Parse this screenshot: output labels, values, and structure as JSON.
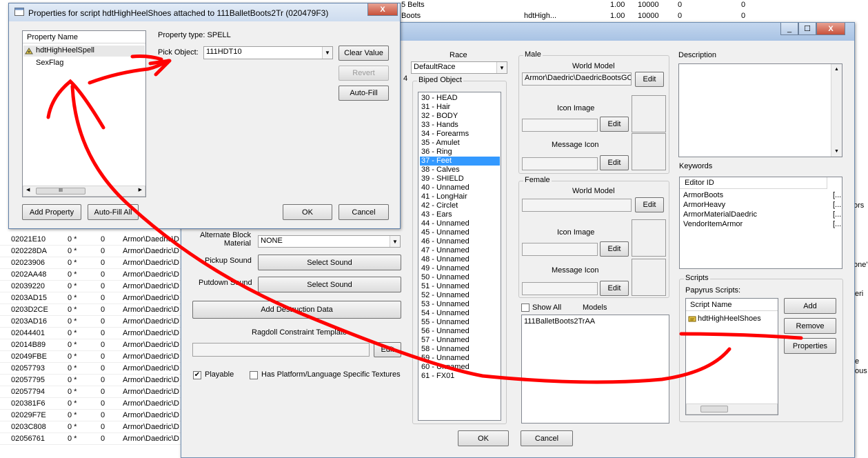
{
  "background_sheet": {
    "top_rows": [
      {
        "name": "5 Belts",
        "v1": "1.00",
        "v2": "10000",
        "v3": "0",
        "v4": "0",
        "extra": ""
      },
      {
        "name": "Boots",
        "v1": "1.00",
        "v2": "10000",
        "v3": "0",
        "v4": "0",
        "extra": "hdtHigh..."
      }
    ],
    "rows": [
      {
        "id": "02021E10",
        "n": "0 *",
        "z": "0",
        "path": "Armor\\Daedric\\D"
      },
      {
        "id": "020228DA",
        "n": "0 *",
        "z": "0",
        "path": "Armor\\Daedric\\D"
      },
      {
        "id": "02023906",
        "n": "0 *",
        "z": "0",
        "path": "Armor\\Daedric\\D"
      },
      {
        "id": "0202AA48",
        "n": "0 *",
        "z": "0",
        "path": "Armor\\Daedric\\D"
      },
      {
        "id": "02039220",
        "n": "0 *",
        "z": "0",
        "path": "Armor\\Daedric\\D"
      },
      {
        "id": "0203AD15",
        "n": "0 *",
        "z": "0",
        "path": "Armor\\Daedric\\D"
      },
      {
        "id": "0203D2CE",
        "n": "0 *",
        "z": "0",
        "path": "Armor\\Daedric\\D"
      },
      {
        "id": "0203AD16",
        "n": "0 *",
        "z": "0",
        "path": "Armor\\Daedric\\D"
      },
      {
        "id": "02044401",
        "n": "0 *",
        "z": "0",
        "path": "Armor\\Daedric\\D"
      },
      {
        "id": "02014B89",
        "n": "0 *",
        "z": "0",
        "path": "Armor\\Daedric\\D"
      },
      {
        "id": "02049FBE",
        "n": "0 *",
        "z": "0",
        "path": "Armor\\Daedric\\D"
      },
      {
        "id": "02057793",
        "n": "0 *",
        "z": "0",
        "path": "Armor\\Daedric\\D"
      },
      {
        "id": "02057795",
        "n": "0 *",
        "z": "0",
        "path": "Armor\\Daedric\\D"
      },
      {
        "id": "02057794",
        "n": "0 *",
        "z": "0",
        "path": "Armor\\Daedric\\D"
      },
      {
        "id": "020381F6",
        "n": "0 *",
        "z": "0",
        "path": "Armor\\Daedric\\D"
      },
      {
        "id": "02029F7E",
        "n": "0 *",
        "z": "0",
        "path": "Armor\\Daedric\\D"
      },
      {
        "id": "0203C808",
        "n": "0 *",
        "z": "0",
        "path": "Armor\\Daedric\\D"
      },
      {
        "id": "02056761",
        "n": "0 *",
        "z": "0",
        "path": "Armor\\Daedric\\D"
      }
    ],
    "right_edge": {
      "a": "ors",
      "b": "one'",
      "c": "eri",
      "d": "e",
      "e": "ous"
    }
  },
  "armor_window": {
    "race_label": "Race",
    "race_value": "DefaultRace",
    "biped_label": "Biped Object",
    "biped_items": [
      "30 - HEAD",
      "31 - Hair",
      "32 - BODY",
      "33 - Hands",
      "34 - Forearms",
      "35 - Amulet",
      "36 - Ring",
      "37 - Feet",
      "38 - Calves",
      "39 - SHIELD",
      "40 - Unnamed",
      "41 - LongHair",
      "42 - Circlet",
      "43 - Ears",
      "44 - Unnamed",
      "45 - Unnamed",
      "46 - Unnamed",
      "47 - Unnamed",
      "48 - Unnamed",
      "49 - Unnamed",
      "50 - Unnamed",
      "51 - Unnamed",
      "52 - Unnamed",
      "53 - Unnamed",
      "54 - Unnamed",
      "55 - Unnamed",
      "56 - Unnamed",
      "57 - Unnamed",
      "58 - Unnamed",
      "59 - Unnamed",
      "60 - Unnamed",
      "61 - FX01"
    ],
    "selected_biped": "37 - Feet",
    "male_label": "Male",
    "female_label": "Female",
    "world_model_label": "World Model",
    "male_world_model": "Armor\\Daedric\\DaedricBootsGO",
    "icon_image_label": "Icon Image",
    "message_icon_label": "Message Icon",
    "edit": "Edit",
    "show_all": "Show All",
    "models_label": "Models",
    "models_item": "111BalletBoots2TrAA",
    "description_label": "Description",
    "keywords_label": "Keywords",
    "editor_id_header": "Editor ID",
    "keywords": [
      "ArmorBoots",
      "ArmorHeavy",
      "ArmorMaterialDaedric",
      "VendorItemArmor"
    ],
    "keyword_suffix": "[...",
    "scripts_label": "Scripts",
    "papyrus_label": "Papyrus Scripts:",
    "script_name_header": "Script Name",
    "scripts": [
      "hdtHighHeelShoes"
    ],
    "add": "Add",
    "remove": "Remove",
    "properties": "Properties",
    "alt_block_label": "Alternate Block Material",
    "alt_block_value": "NONE",
    "pickup_label": "Pickup Sound",
    "putdown_label": "Putdown Sound",
    "select_sound": "Select Sound",
    "add_destruction": "Add Destruction Data",
    "ragdoll_label": "Ragdoll Constraint Template",
    "playable": "Playable",
    "has_platform": "Has Platform/Language Specific Textures",
    "ok": "OK",
    "cancel": "Cancel",
    "stray_num": "4",
    "min": "_",
    "max": "☐",
    "close": "X"
  },
  "props_dialog": {
    "title": "Properties for script hdtHighHeelShoes attached to 111BalletBoots2Tr (020479F3)",
    "property_name_header": "Property Name",
    "properties": [
      "hdtHighHeelSpell",
      "SexFlag"
    ],
    "property_type_label": "Property type: SPELL",
    "pick_object_label": "Pick Object:",
    "pick_object_value": "111HDT10",
    "clear_value": "Clear Value",
    "revert": "Revert",
    "auto_fill": "Auto-Fill",
    "add_property": "Add Property",
    "auto_fill_all": "Auto-Fill All",
    "ok": "OK",
    "cancel": "Cancel",
    "close": "X",
    "scroll_thumb": "III"
  },
  "colors": {
    "selection": "#3399ff",
    "annotation": "#ff0000"
  }
}
